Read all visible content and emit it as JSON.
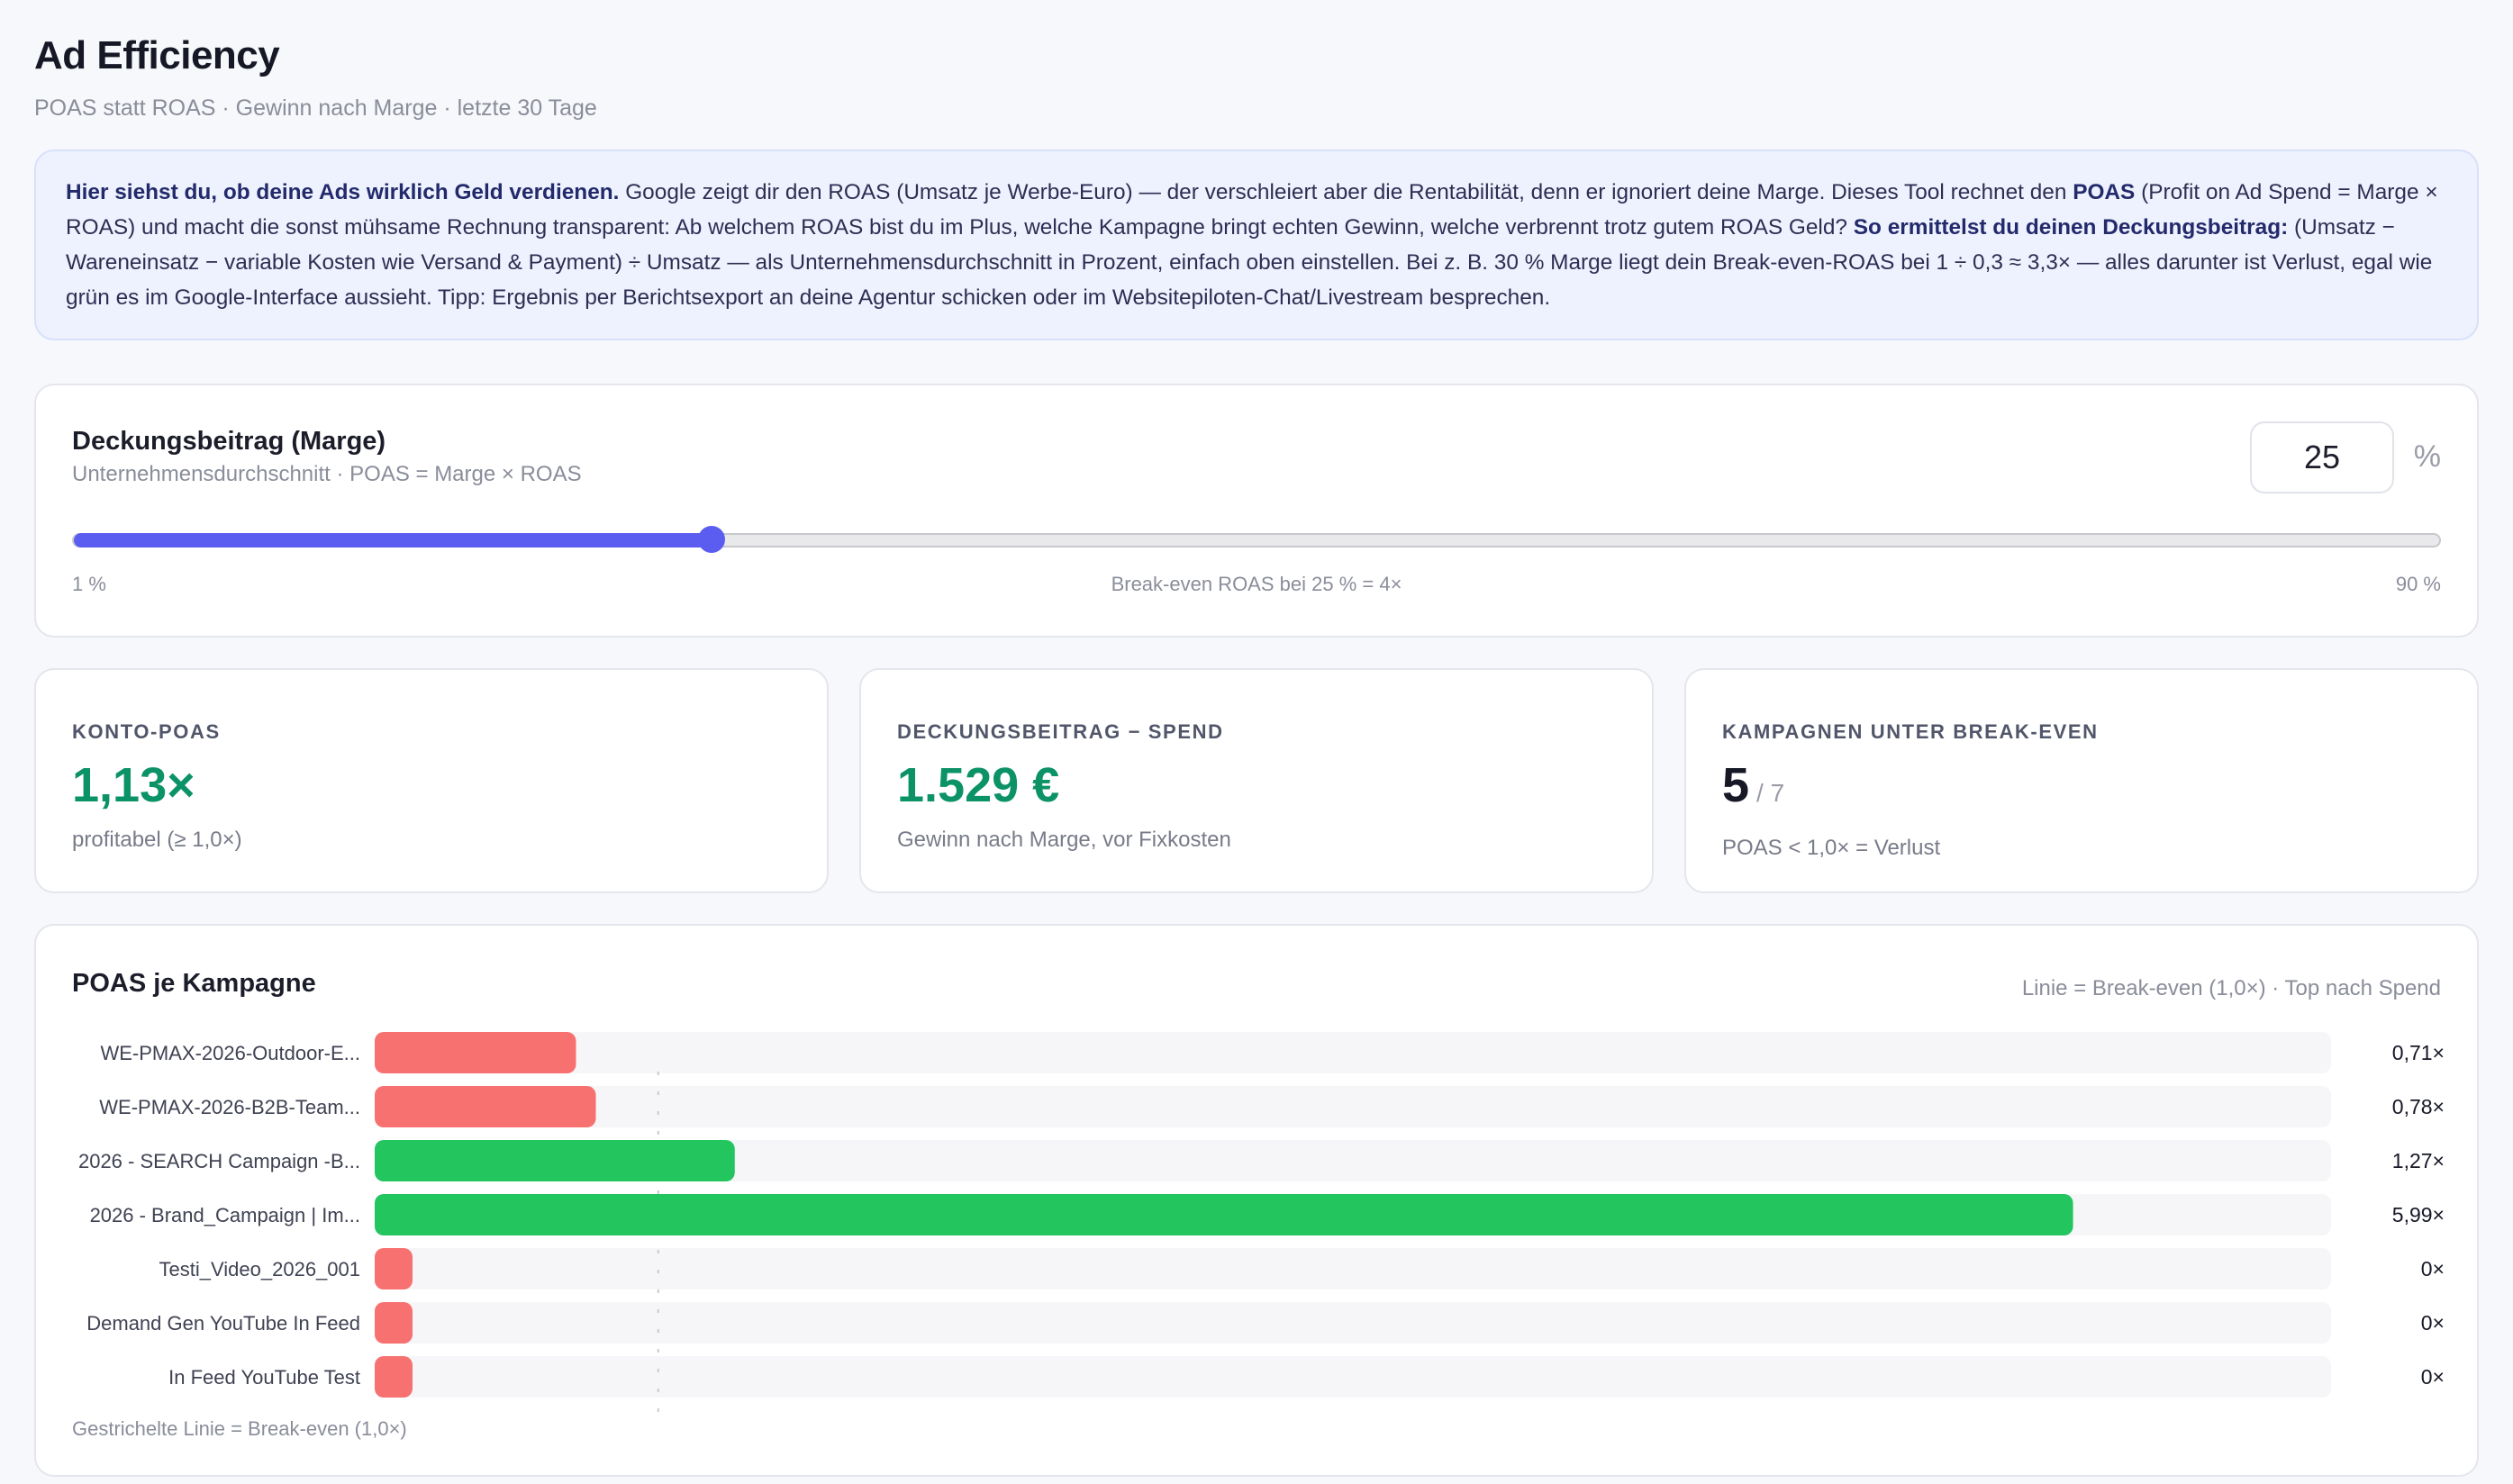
{
  "header": {
    "title": "Ad Efficiency",
    "subtitle": "POAS statt ROAS · Gewinn nach Marge · letzte 30 Tage"
  },
  "info": {
    "lead": "Hier siehst du, ob deine Ads wirklich Geld verdienen.",
    "t1": " Google zeigt dir den ROAS (Umsatz je Werbe-Euro) — der verschleiert aber die Rentabilität, denn er ignoriert deine Marge. Dieses Tool rechnet den ",
    "poas": "POAS",
    "t2": " (Profit on Ad Spend = Marge × ROAS) und macht die sonst mühsame Rechnung transparent: Ab welchem ROAS bist du im Plus, welche Kampagne bringt echten Gewinn, welche verbrennt trotz gutem ROAS Geld? ",
    "howto": "So ermittelst du deinen Deckungsbeitrag:",
    "t3": " (Umsatz − Wareneinsatz − variable Kosten wie Versand & Payment) ÷ Umsatz — als Unternehmensdurchschnitt in Prozent, einfach oben einstellen. Bei z. B. 30 % Marge liegt dein Break-even-ROAS bei 1 ÷ 0,3 ≈ 3,3× — alles darunter ist Verlust, egal wie grün es im Google-Interface aussieht. Tipp: Ergebnis per Berichtsexport an deine Agentur schicken oder im Websitepiloten-Chat/Livestream besprechen."
  },
  "margin": {
    "title": "Deckungsbeitrag (Marge)",
    "subtitle": "Unternehmensdurchschnitt · POAS = Marge × ROAS",
    "value": "25",
    "unit": "%",
    "slider": {
      "min": 1,
      "max": 90,
      "value": 25
    },
    "min_label": "1 %",
    "mid_label": "Break-even ROAS bei 25 % = 4×",
    "max_label": "90 %"
  },
  "kpis": [
    {
      "label": "KONTO-POAS",
      "value": "1,13×",
      "note": "profitabel (≥ 1,0×)"
    },
    {
      "label": "DECKUNGSBEITRAG − SPEND",
      "value": "1.529 €",
      "note": "Gewinn nach Marge, vor Fixkosten"
    },
    {
      "label": "KAMPAGNEN UNTER BREAK-EVEN",
      "value": "5",
      "total": "/ 7",
      "note": "POAS < 1,0× = Verlust"
    }
  ],
  "chart": {
    "title": "POAS je Kampagne",
    "note": "Linie = Break-even (1,0×) · Top nach Spend",
    "footer": "Gestrichelte Linie = Break-even (1,0×)"
  },
  "colors": {
    "accent": "#5b5df0",
    "positive": "#22c55e",
    "negative": "#f87171",
    "kpi_green": "#0c9267"
  },
  "chart_data": {
    "type": "bar",
    "orientation": "horizontal",
    "categories": [
      "WE-PMAX-2026-Outdoor-E...",
      "WE-PMAX-2026-B2B-Team...",
      "2026 - SEARCH Campaign -B...",
      "2026 - Brand_Campaign | Im...",
      "Testi_Video_2026_001",
      "Demand Gen YouTube In Feed",
      "In Feed YouTube Test"
    ],
    "values": [
      0.71,
      0.78,
      1.27,
      5.99,
      0,
      0,
      0
    ],
    "value_labels": [
      "0,71×",
      "0,78×",
      "1,27×",
      "5,99×",
      "0×",
      "0×",
      "0×"
    ],
    "break_even": 1.0,
    "xlim": [
      0,
      6.9
    ],
    "title": "POAS je Kampagne"
  }
}
